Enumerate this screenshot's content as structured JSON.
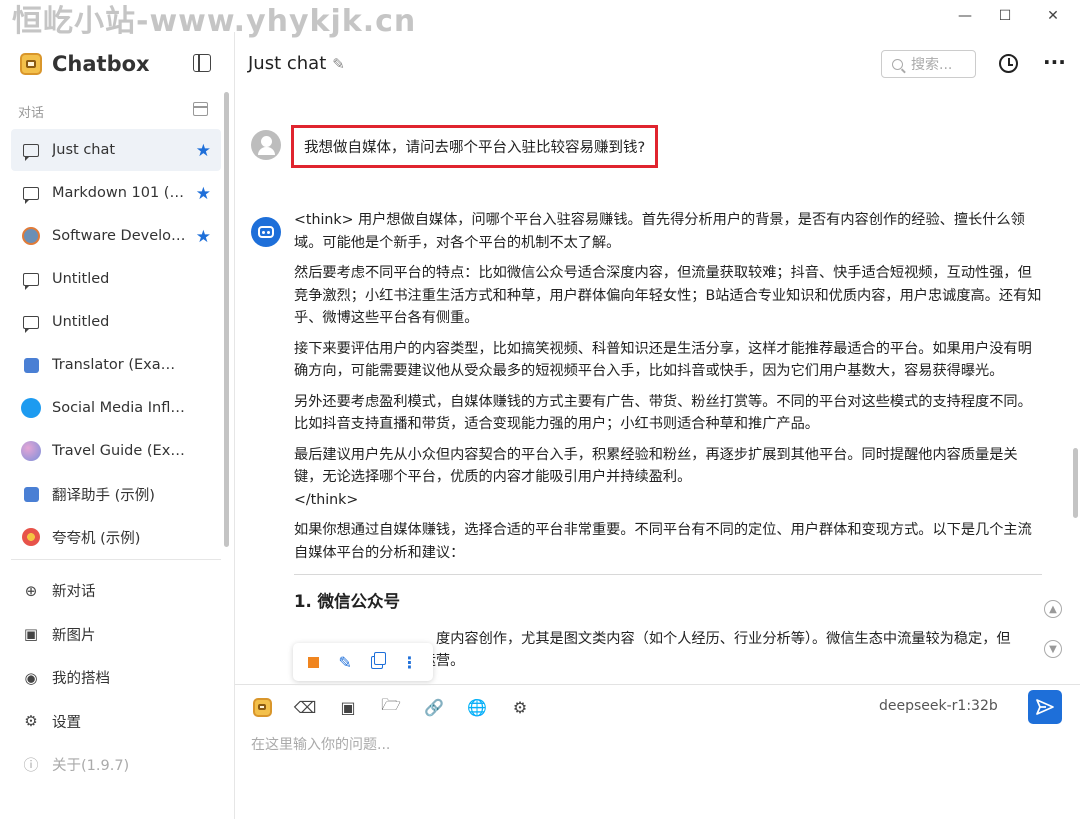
{
  "watermark": "恒屹小站-www.yhykjk.cn",
  "window": {
    "app_name": "Chatbox"
  },
  "sidebar": {
    "title": "Chatbox",
    "section_label": "对话",
    "conversations": [
      {
        "label": "Just chat",
        "icon": "chat-bubble-icon",
        "starred": true,
        "active": true
      },
      {
        "label": "Markdown 101 (Example)",
        "icon": "chat-bubble-icon",
        "starred": true
      },
      {
        "label": "Software Developer (Example)",
        "icon": "developer-avatar-icon",
        "starred": true
      },
      {
        "label": "Untitled",
        "icon": "chat-bubble-icon"
      },
      {
        "label": "Untitled",
        "icon": "chat-bubble-icon"
      },
      {
        "label": "Translator (Example)",
        "icon": "translator-avatar-icon"
      },
      {
        "label": "Social Media Influencer (Example)",
        "icon": "twitter-avatar-icon"
      },
      {
        "label": "Travel Guide (Example)",
        "icon": "globe-avatar-icon"
      },
      {
        "label": "翻译助手 (示例)",
        "icon": "translator-avatar-icon"
      },
      {
        "label": "夸夸机 (示例)",
        "icon": "flower-avatar-icon"
      }
    ],
    "actions": [
      {
        "label": "新对话",
        "icon": "plus-circle-icon"
      },
      {
        "label": "新图片",
        "icon": "image-plus-icon"
      },
      {
        "label": "我的搭档",
        "icon": "robot-icon"
      },
      {
        "label": "设置",
        "icon": "gear-icon"
      },
      {
        "label": "关于(1.9.7)",
        "icon": "info-icon"
      }
    ]
  },
  "header": {
    "title": "Just chat",
    "search_placeholder": "搜索..."
  },
  "chat": {
    "user_message": "我想做自媒体，请问去哪个平台入驻比较容易赚到钱?",
    "assistant_paragraphs": [
      "<think> 用户想做自媒体，问哪个平台入驻容易赚钱。首先得分析用户的背景，是否有内容创作的经验、擅长什么领域。可能他是个新手，对各个平台的机制不太了解。",
      "然后要考虑不同平台的特点：比如微信公众号适合深度内容，但流量获取较难；抖音、快手适合短视频，互动性强，但竞争激烈；小红书注重生活方式和种草，用户群体偏向年轻女性；B站适合专业知识和优质内容，用户忠诚度高。还有知乎、微博这些平台各有侧重。",
      "接下来要评估用户的内容类型，比如搞笑视频、科普知识还是生活分享，这样才能推荐最适合的平台。如果用户没有明确方向，可能需要建议他从受众最多的短视频平台入手，比如抖音或快手，因为它们用户基数大，容易获得曝光。",
      "另外还要考虑盈利模式，自媒体赚钱的方式主要有广告、带货、粉丝打赏等。不同的平台对这些模式的支持程度不同。比如抖音支持直播和带货，适合变现能力强的用户；小红书则适合种草和推广产品。",
      "最后建议用户先从小众但内容契合的平台入手，积累经验和粉丝，再逐步扩展到其他平台。同时提醒他内容质量是关键，无论选择哪个平台，优质的内容才能吸引用户并持续盈利。",
      "</think>",
      "如果你想通过自媒体赚钱，选择合适的平台非常重要。不同平台有不同的定位、用户群体和变现方式。以下是几个主流自媒体平台的分析和建议："
    ],
    "heading": "1. 微信公众号",
    "partial_line_1": "度内容创作，尤其是图文类内容（如个人经历、行业分析等）。微信生态中流量较为稳定，但",
    "partial_line_2": "粉丝积累需要时间和运营。"
  },
  "composer": {
    "placeholder": "在这里输入你的问题...",
    "model": "deepseek-r1:32b"
  },
  "colors": {
    "accent": "#1e6fd9",
    "highlight_border": "#e0242e",
    "stop": "#f0851f"
  }
}
